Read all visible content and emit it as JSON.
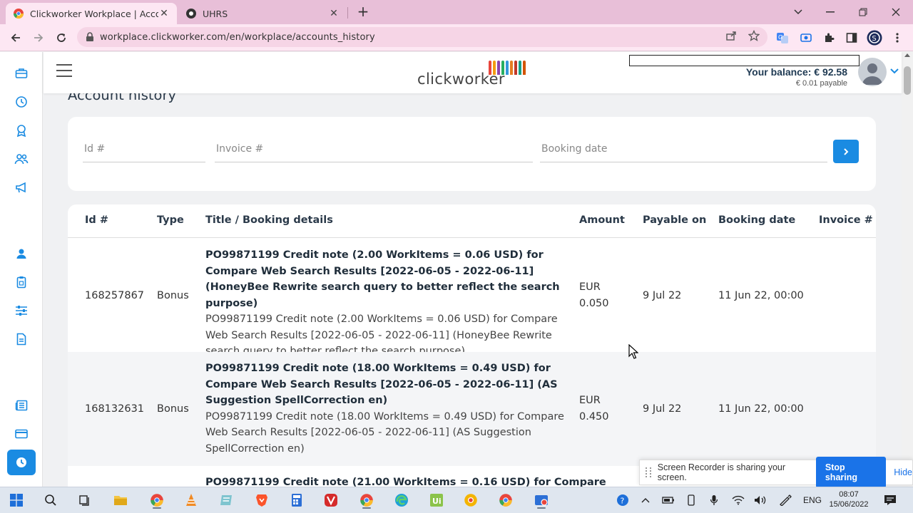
{
  "browser": {
    "tabs": [
      {
        "title": "Clickworker Workplace | Account",
        "active": true,
        "icon": "chrome-favicon"
      },
      {
        "title": "UHRS",
        "active": false,
        "icon": "uhrs-favicon"
      }
    ],
    "url": "workplace.clickworker.com/en/workplace/accounts_history"
  },
  "header": {
    "logo_text": "clickworker",
    "balance": "Your balance: € 92.58",
    "payable": "€ 0.01 payable"
  },
  "page": {
    "title": "Account history"
  },
  "filters": {
    "id_placeholder": "Id #",
    "invoice_placeholder": "Invoice #",
    "booking_date_placeholder": "Booking date"
  },
  "table": {
    "columns": [
      "Id #",
      "Type",
      "Title / Booking details",
      "Amount",
      "Payable on",
      "Booking date",
      "Invoice #"
    ],
    "rows": [
      {
        "id": "168257867",
        "type": "Bonus",
        "title": "PO99871199 Credit note (2.00 WorkItems = 0.06 USD) for Compare Web Search Results [2022-06-05 - 2022-06-11] (HoneyBee Rewrite search query to better reflect the search purpose)",
        "details": "PO99871199 Credit note (2.00 WorkItems = 0.06 USD) for Compare Web Search Results [2022-06-05 - 2022-06-11] (HoneyBee Rewrite search query to better reflect the search purpose)",
        "currency": "EUR",
        "amount": "0.050",
        "payable_on": "9 Jul 22",
        "booking_date": "11 Jun 22, 00:00",
        "invoice": ""
      },
      {
        "id": "168132631",
        "type": "Bonus",
        "title": "PO99871199 Credit note (18.00 WorkItems = 0.49 USD) for Compare Web Search Results [2022-06-05 - 2022-06-11] (AS Suggestion SpellCorrection en)",
        "details": "PO99871199 Credit note (18.00 WorkItems = 0.49 USD) for Compare Web Search Results [2022-06-05 - 2022-06-11] (AS Suggestion SpellCorrection en)",
        "currency": "EUR",
        "amount": "0.450",
        "payable_on": "9 Jul 22",
        "booking_date": "11 Jun 22, 00:00",
        "invoice": ""
      },
      {
        "title": "PO99871199 Credit note (21.00 WorkItems = 0.16 USD) for Compare"
      }
    ]
  },
  "share_bar": {
    "message": "Screen Recorder is sharing your screen.",
    "stop_label": "Stop sharing",
    "hide_label": "Hide"
  },
  "taskbar": {
    "language": "ENG",
    "time": "08:07",
    "date": "15/06/2022"
  },
  "colors": {
    "accent": "#1a8be2",
    "tab_strip": "#e8bfd8",
    "toolbar": "#fde7f3",
    "page_bg": "#f0f1f3"
  }
}
